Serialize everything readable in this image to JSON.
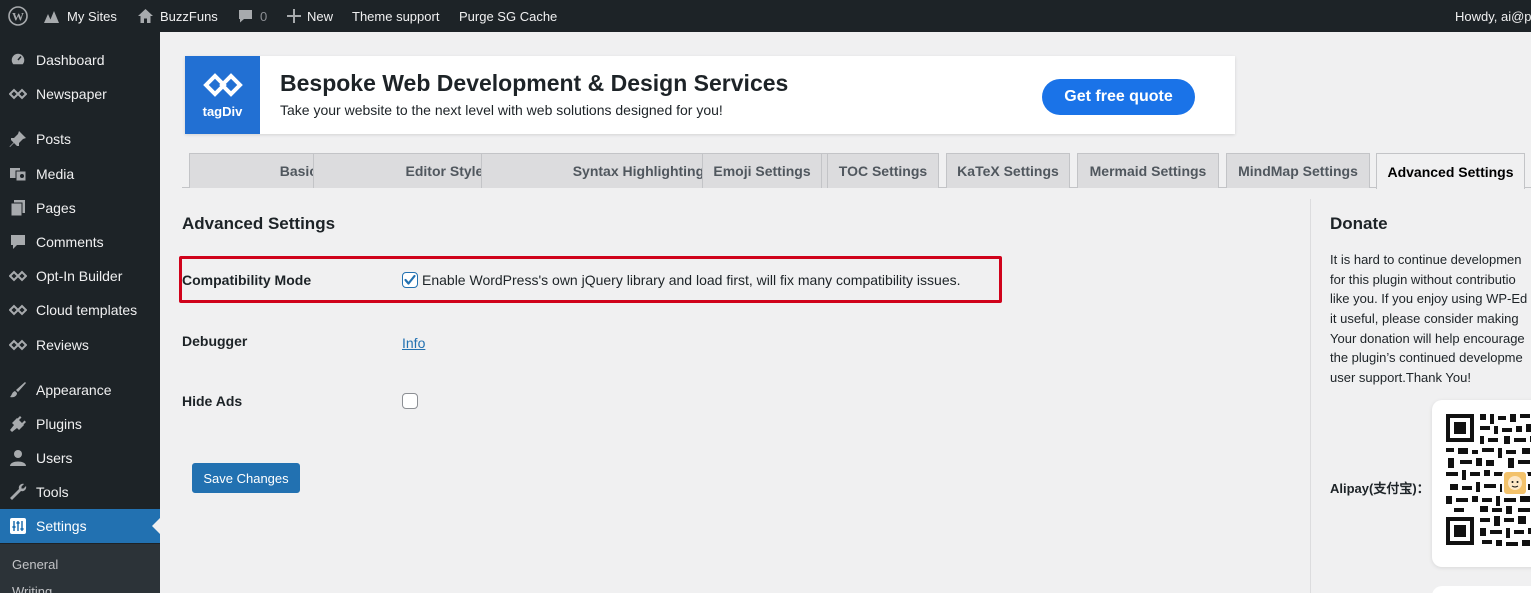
{
  "admin_bar": {
    "my_sites": "My Sites",
    "site_name": "BuzzFuns",
    "comments_count": "0",
    "new_label": "New",
    "theme_support": "Theme support",
    "purge_cache": "Purge SG Cache",
    "howdy": "Howdy, ai@p"
  },
  "sidebar": {
    "items": [
      {
        "label": "Dashboard",
        "icon": "dashboard-icon"
      },
      {
        "label": "Newspaper",
        "icon": "newspaper-icon"
      },
      {
        "label": "Posts",
        "icon": "pin-icon"
      },
      {
        "label": "Media",
        "icon": "media-icon"
      },
      {
        "label": "Pages",
        "icon": "pages-icon"
      },
      {
        "label": "Comments",
        "icon": "comment-icon"
      },
      {
        "label": "Opt-In Builder",
        "icon": "tagdiv-icon"
      },
      {
        "label": "Cloud templates",
        "icon": "tagdiv-icon"
      },
      {
        "label": "Reviews",
        "icon": "tagdiv-icon"
      },
      {
        "label": "Appearance",
        "icon": "brush-icon"
      },
      {
        "label": "Plugins",
        "icon": "plug-icon"
      },
      {
        "label": "Users",
        "icon": "user-icon"
      },
      {
        "label": "Tools",
        "icon": "wrench-icon"
      },
      {
        "label": "Settings",
        "icon": "settings-icon"
      }
    ],
    "submenu": [
      "General",
      "Writing"
    ]
  },
  "banner": {
    "logo_text": "tagDiv",
    "title": "Bespoke Web Development & Design Services",
    "subtitle": "Take your website to the next level with web solutions designed for you!",
    "cta": "Get free quote"
  },
  "tabs": [
    "Basic Settings",
    "Editor Style Settings",
    "Syntax Highlighting Settings",
    "Emoji Settings",
    "TOC Settings",
    "KaTeX Settings",
    "Mermaid Settings",
    "MindMap Settings",
    "Advanced Settings"
  ],
  "active_tab": "Advanced Settings",
  "main": {
    "heading": "Advanced Settings",
    "compat_label": "Compatibility Mode",
    "compat_desc": "Enable WordPress's own jQuery library and load first, will fix many compatibility issues.",
    "compat_checked": true,
    "debugger_label": "Debugger",
    "debugger_link": "Info",
    "hide_ads_label": "Hide Ads",
    "hide_ads_checked": false,
    "save_button": "Save Changes"
  },
  "donate": {
    "title": "Donate",
    "lines": [
      "It is hard to continue developmen",
      "for this plugin without contributio",
      "like you. If you enjoy using WP-Ed",
      "it useful, please consider making",
      "Your donation will help encourage",
      "the plugin’s continued developme",
      "user support.Thank You!"
    ],
    "alipay_label": "Alipay(支付宝)："
  },
  "colors": {
    "admin_bg": "#1d2327",
    "accent": "#2271b1",
    "banner_blue": "#2270d3",
    "cta_blue": "#1a73e8",
    "highlight_red": "#d0021b"
  }
}
